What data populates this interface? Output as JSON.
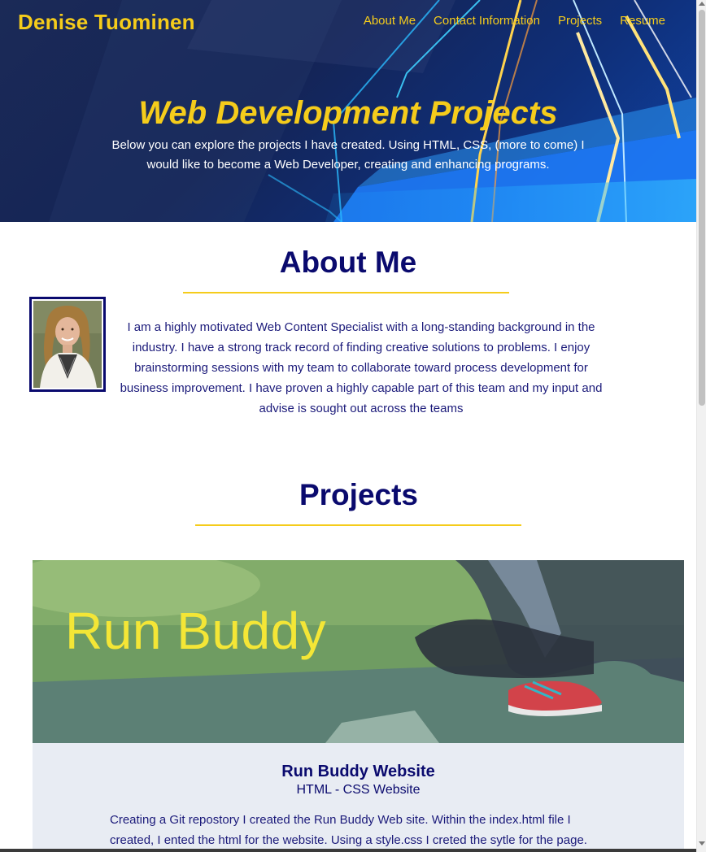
{
  "header": {
    "site_name": "Denise Tuominen",
    "nav": [
      "About Me",
      "Contact Information",
      "Projects",
      "Resume"
    ]
  },
  "hero": {
    "title": "Web Development Projects",
    "text": "Below you can explore the projects I have created. Using HTML, CSS, (more to come) I would like to become a Web Developer, creating and enhancing programs."
  },
  "about": {
    "title": "About Me",
    "text": "I am a highly motivated Web Content Specialist with a long-standing background in the industry. I have a strong track record of finding creative solutions to problems. I enjoy brainstorming sessions with my team to collaborate toward process development for business improvement. I have proven a highly capable part of this team and my input and advise is sought out across the teams"
  },
  "projects": {
    "title": "Projects",
    "items": [
      {
        "image_label": "Run Buddy",
        "title": "Run Buddy Website",
        "subtitle": "HTML - CSS Website",
        "description": "Creating a Git repostory I created the Run Buddy Web site. Within the index.html file I created, I ented the html for the website. Using a style.css I creted the sytle for the page."
      }
    ]
  },
  "colors": {
    "accent": "#f5cc1b",
    "heading": "#0a0a6e",
    "body_text": "#1b1a7a",
    "card_bg": "#e8ecf3"
  }
}
